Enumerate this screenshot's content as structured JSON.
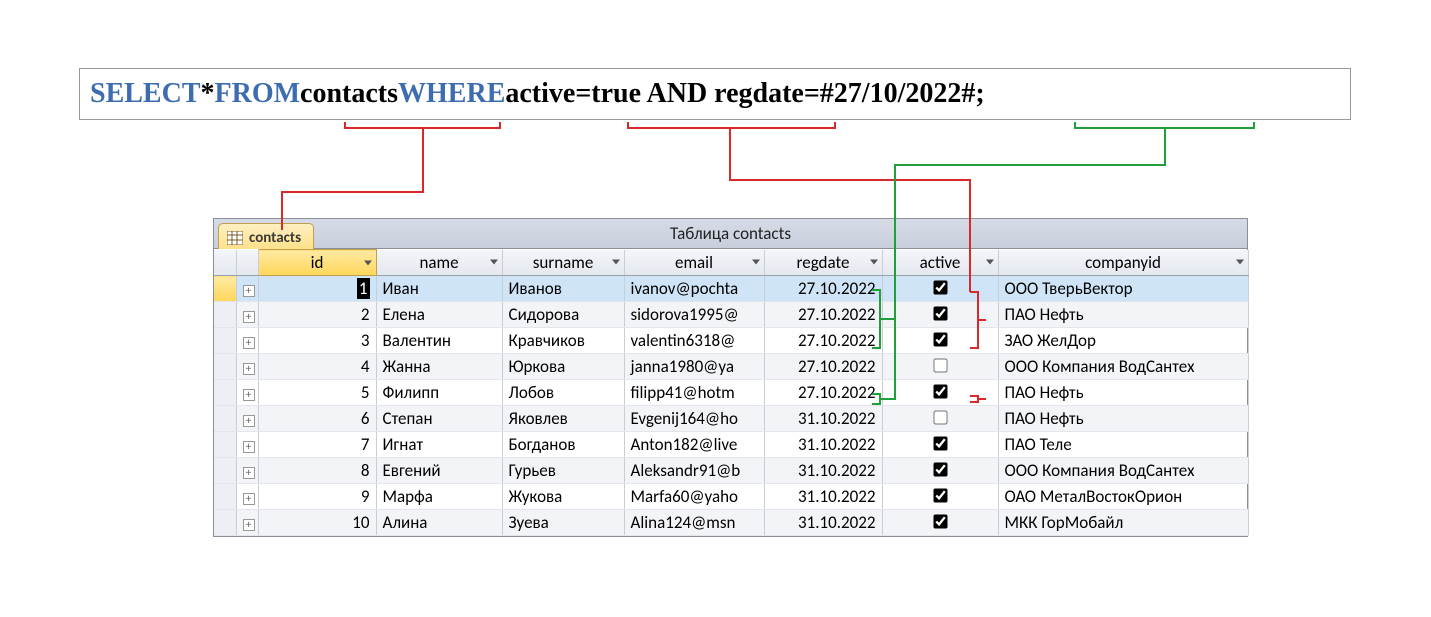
{
  "sql": {
    "select": "SELECT",
    "star": " * ",
    "from": "FROM",
    "table": " contacts ",
    "where": "WHERE",
    "cond": " active=true AND regdate=#27/10/2022#;"
  },
  "window": {
    "tab_label": "contacts",
    "title": "Таблица contacts"
  },
  "columns": {
    "id": "id",
    "name": "name",
    "surname": "surname",
    "email": "email",
    "regdate": "regdate",
    "active": "active",
    "companyid": "companyid"
  },
  "rows": [
    {
      "id": "1",
      "name": "Иван",
      "surname": "Иванов",
      "email": "ivanov@pochta",
      "regdate": "27.10.2022",
      "active": true,
      "company": "ООО ТверьВектор"
    },
    {
      "id": "2",
      "name": "Елена",
      "surname": "Сидорова",
      "email": "sidorova1995@",
      "regdate": "27.10.2022",
      "active": true,
      "company": "ПАО Нефть"
    },
    {
      "id": "3",
      "name": "Валентин",
      "surname": "Кравчиков",
      "email": "valentin6318@",
      "regdate": "27.10.2022",
      "active": true,
      "company": "ЗАО ЖелДор"
    },
    {
      "id": "4",
      "name": "Жанна",
      "surname": "Юркова",
      "email": "janna1980@ya",
      "regdate": "27.10.2022",
      "active": false,
      "company": "ООО Компания ВодСантех"
    },
    {
      "id": "5",
      "name": "Филипп",
      "surname": "Лобов",
      "email": "filipp41@hotm",
      "regdate": "27.10.2022",
      "active": true,
      "company": "ПАО Нефть"
    },
    {
      "id": "6",
      "name": "Степан",
      "surname": "Яковлев",
      "email": "Evgenij164@ho",
      "regdate": "31.10.2022",
      "active": false,
      "company": "ПАО Нефть"
    },
    {
      "id": "7",
      "name": "Игнат",
      "surname": "Богданов",
      "email": "Anton182@live",
      "regdate": "31.10.2022",
      "active": true,
      "company": "ПАО Теле"
    },
    {
      "id": "8",
      "name": "Евгений",
      "surname": "Гурьев",
      "email": "Aleksandr91@b",
      "regdate": "31.10.2022",
      "active": true,
      "company": "ООО Компания ВодСантех"
    },
    {
      "id": "9",
      "name": "Марфа",
      "surname": "Жукова",
      "email": "Marfa60@yaho",
      "regdate": "31.10.2022",
      "active": true,
      "company": "ОАО МеталВостокОрион"
    },
    {
      "id": "10",
      "name": "Алина",
      "surname": "Зуева",
      "email": "Alina124@msn",
      "regdate": "31.10.2022",
      "active": true,
      "company": "МКК ГорМобайл"
    }
  ],
  "colors": {
    "keyword": "#3D6CB0",
    "red_line": "#d82a2a",
    "green_line": "#1fa03a"
  }
}
